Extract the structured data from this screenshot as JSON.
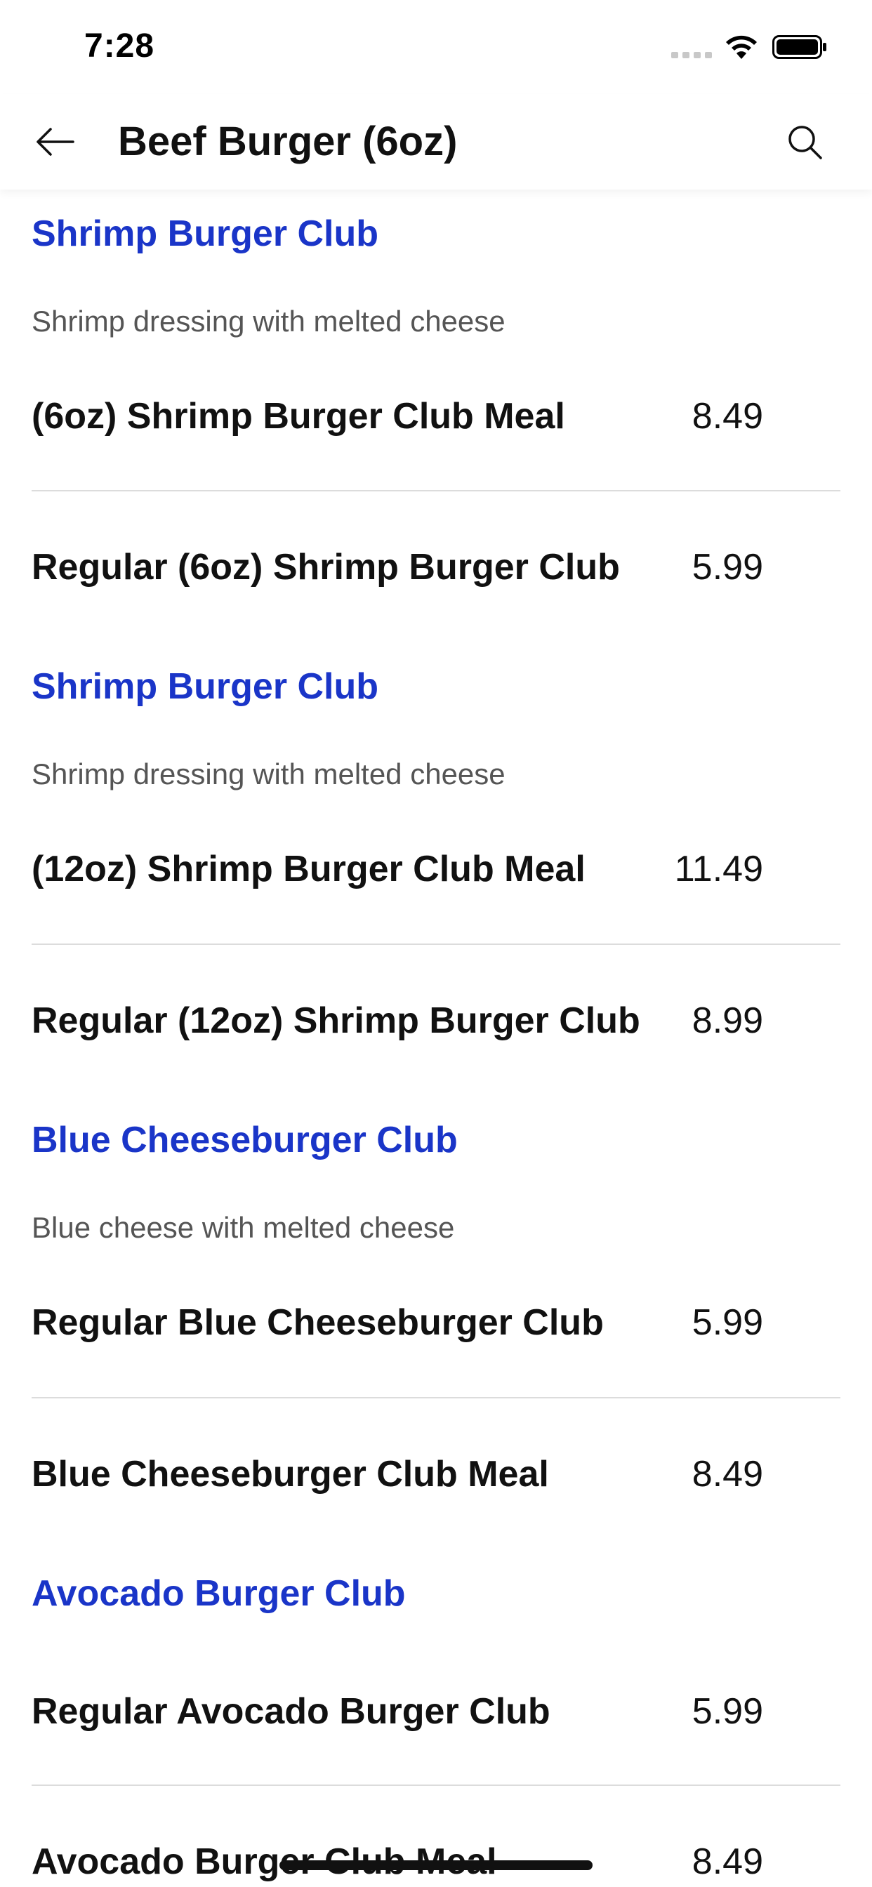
{
  "status_bar": {
    "time": "7:28",
    "icons": [
      "cellular-signal-icon",
      "wifi-icon",
      "battery-icon"
    ]
  },
  "header": {
    "title": "Beef Burger (6oz)",
    "back_icon": "arrow-left-icon",
    "search_icon": "search-icon"
  },
  "colors": {
    "section_title": "#1a35c8",
    "description": "#555555",
    "text": "#111111",
    "divider": "#dcdcdc"
  },
  "menu": {
    "sections": [
      {
        "title": "Shrimp Burger Club",
        "description": "Shrimp dressing with melted cheese",
        "items": [
          {
            "name": "(6oz) Shrimp Burger Club Meal",
            "price": "8.49"
          },
          {
            "name": "Regular (6oz) Shrimp Burger Club",
            "price": "5.99"
          }
        ]
      },
      {
        "title": "Shrimp Burger Club",
        "description": "Shrimp dressing with melted cheese",
        "items": [
          {
            "name": "(12oz) Shrimp Burger Club Meal",
            "price": "11.49"
          },
          {
            "name": "Regular (12oz) Shrimp Burger Club",
            "price": "8.99"
          }
        ]
      },
      {
        "title": "Blue Cheeseburger Club",
        "description": "Blue cheese with melted cheese",
        "items": [
          {
            "name": "Regular Blue Cheeseburger Club",
            "price": "5.99"
          },
          {
            "name": "Blue Cheeseburger Club Meal",
            "price": "8.49"
          }
        ]
      },
      {
        "title": "Avocado Burger Club",
        "items": [
          {
            "name": "Regular Avocado Burger Club",
            "price": "5.99"
          },
          {
            "name": "Avocado Burger Club Meal",
            "price": "8.49"
          }
        ]
      }
    ]
  }
}
